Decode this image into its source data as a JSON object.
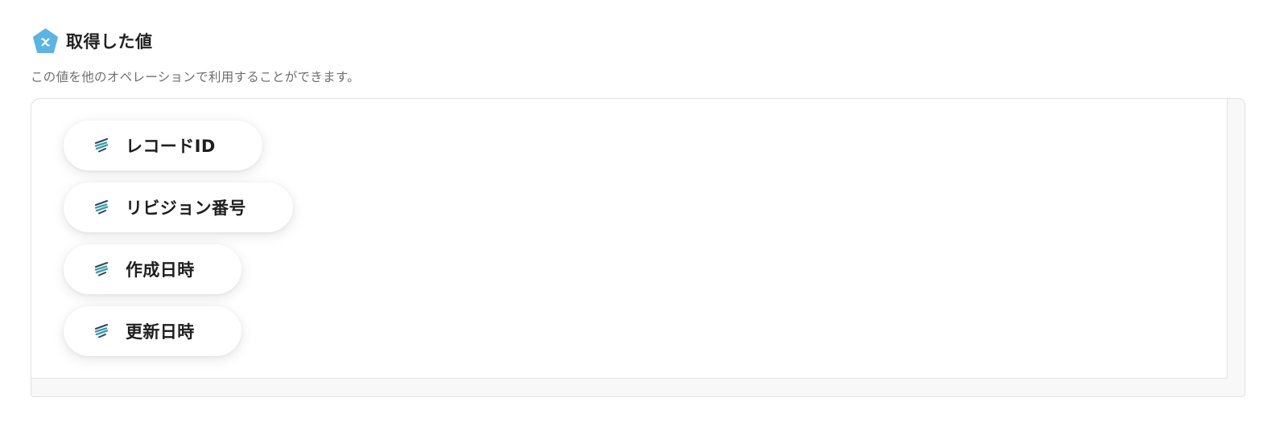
{
  "section": {
    "title": "取得した値",
    "description": "この値を他のオペレーションで利用することができます。",
    "icon": "variable-x-icon",
    "icon_color": "#5ab4e5"
  },
  "values": [
    {
      "label": "レコードID",
      "icon": "app-logo-icon"
    },
    {
      "label": "リビジョン番号",
      "icon": "app-logo-icon"
    },
    {
      "label": "作成日時",
      "icon": "app-logo-icon"
    },
    {
      "label": "更新日時",
      "icon": "app-logo-icon"
    }
  ],
  "colors": {
    "accent": "#5ab4e5",
    "logo_teal": "#3a9cae",
    "logo_dark": "#2f4a5c"
  }
}
